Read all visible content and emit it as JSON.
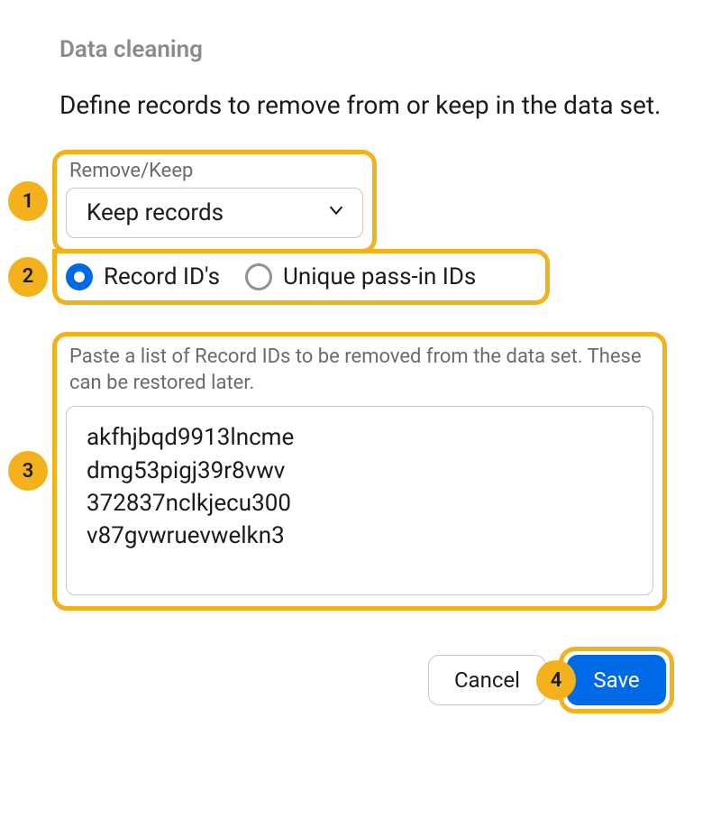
{
  "colors": {
    "accent": "#006ae6",
    "highlight": "#f3b21b"
  },
  "annotations": {
    "box1": "1",
    "box2": "2",
    "box3": "3",
    "box4": "4"
  },
  "header": {
    "section": "Data cleaning",
    "description": "Define records to remove from or keep in the data set."
  },
  "select": {
    "label": "Remove/Keep",
    "value": "Keep records"
  },
  "radios": {
    "record_ids": {
      "label": "Record ID's",
      "selected": true
    },
    "unique_passin": {
      "label": "Unique pass-in IDs",
      "selected": false
    }
  },
  "paste": {
    "hint": "Paste a list of Record IDs to be removed from the data set. These can be restored later.",
    "value": "akfhjbqd9913lncme\ndmg53pigj39r8vwv\n372837nclkjecu300\nv87gvwruevwelkn3"
  },
  "buttons": {
    "cancel": "Cancel",
    "save": "Save"
  }
}
